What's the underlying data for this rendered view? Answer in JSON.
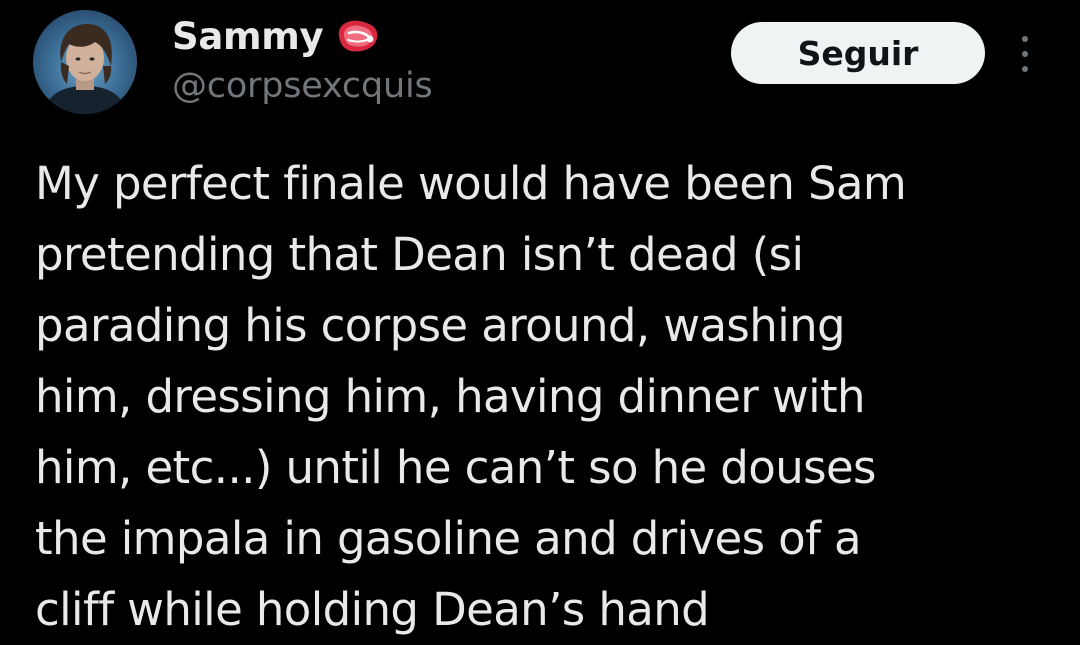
{
  "author": {
    "display_name": "Sammy",
    "emoji_icon": "steak-emoji-icon",
    "handle": "@corpsexcquis",
    "avatar_icon": "profile-photo-avatar"
  },
  "follow_button": {
    "label": "Seguir"
  },
  "more_menu_icon": "vertical-ellipsis-icon",
  "tweet": {
    "lines": [
      "My perfect finale would have been Sam",
      "pretending that Dean isn’t dead (si",
      "parading his corpse around, washing",
      "him, dressing him, having dinner with",
      "him, etc...) until he can’t so he douses",
      "the impala in gasoline and drives of a",
      "cliff while holding Dean’s hand"
    ]
  },
  "colors": {
    "background": "#000000",
    "primary_text": "#e7e9ea",
    "secondary_text": "#71767b",
    "button_background": "#eff3f4",
    "button_text": "#0f1419"
  }
}
